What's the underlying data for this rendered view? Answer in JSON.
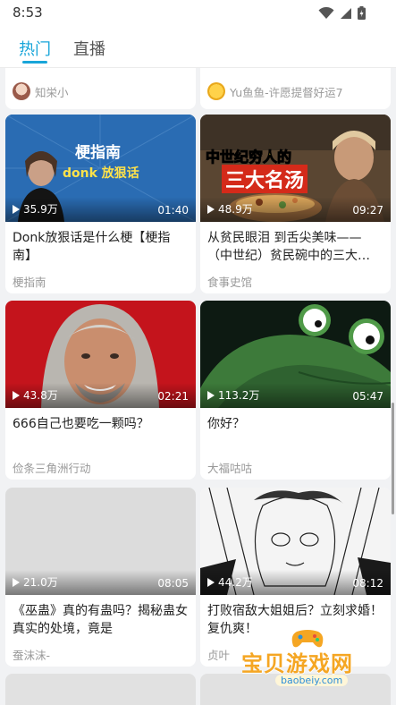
{
  "status": {
    "time": "8:53"
  },
  "tabs": [
    {
      "label": "热门",
      "active": true
    },
    {
      "label": "直播",
      "active": false
    }
  ],
  "partial_top": [
    {
      "author": "知栄小"
    },
    {
      "author": "Yu鱼鱼-许愿提督好运7"
    }
  ],
  "cards": [
    {
      "views": "35.9万",
      "duration": "01:40",
      "title": "Donk放狠话是什么梗【梗指南】",
      "author": "梗指南",
      "thumb_text": {
        "line1": "梗指南",
        "line2": "donk 放狠话"
      }
    },
    {
      "views": "48.9万",
      "duration": "09:27",
      "title": "从贫民眼泪 到舌尖美味——（中世纪）贫民碗中的三大…",
      "author": "食事史馆",
      "thumb_text": {
        "line1": "中世纪穷人的",
        "line2": "三大名汤"
      }
    },
    {
      "views": "43.8万",
      "duration": "02:21",
      "title": "666自己也要吃一颗吗？",
      "author": "俭条三角洲行动"
    },
    {
      "views": "113.2万",
      "duration": "05:47",
      "title": "你好？",
      "author": "大福咕咕"
    },
    {
      "views": "21.0万",
      "duration": "08:05",
      "title": "《巫蛊》真的有蛊吗？揭秘蛊女真实的处境，竟是",
      "author": "蚕沫沫-"
    },
    {
      "views": "44.2万",
      "duration": "08:12",
      "title": "打败宿敌大姐姐后？立刻求婚！复仇爽！",
      "author": "贞叶"
    }
  ],
  "watermark": {
    "brand": "宝贝游戏网",
    "url": "baobeiy.com"
  },
  "colors": {
    "accent": "#18a5d9",
    "background": "#f1f2f4",
    "card": "#ffffff"
  }
}
